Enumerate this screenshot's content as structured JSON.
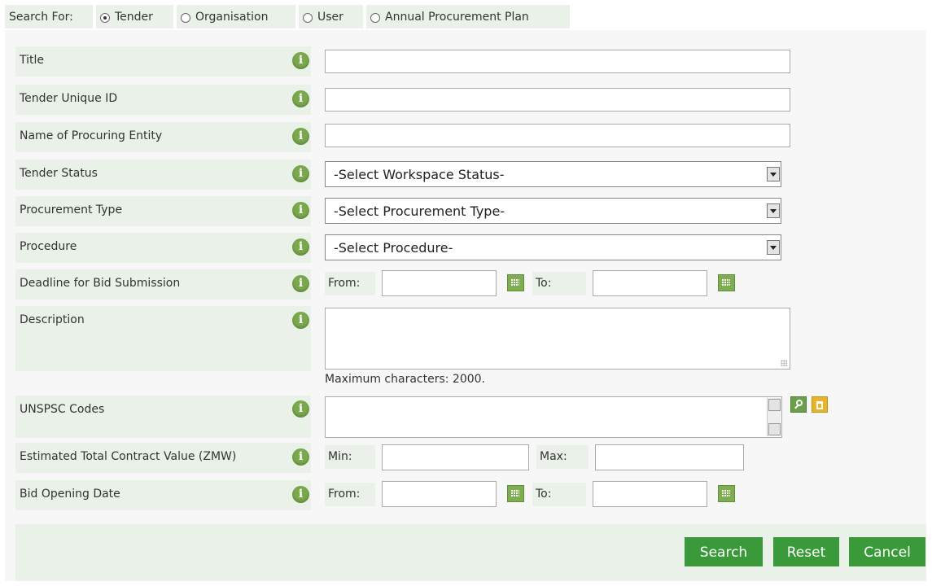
{
  "search_for": {
    "label": "Search For:",
    "options": [
      "Tender",
      "Organisation",
      "User",
      "Annual Procurement Plan"
    ],
    "selected": "Tender"
  },
  "fields": {
    "title": "Title",
    "tender_unique_id": "Tender Unique ID",
    "procuring_entity": "Name of Procuring Entity",
    "tender_status": "Tender Status",
    "procurement_type": "Procurement Type",
    "procedure": "Procedure",
    "deadline": "Deadline for Bid Submission",
    "description": "Description",
    "unspsc": "UNSPSC Codes",
    "contract_value": "Estimated Total Contract Value (ZMW)",
    "bid_opening": "Bid Opening Date"
  },
  "selects": {
    "tender_status": "-Select Workspace Status-",
    "procurement_type": "-Select Procurement Type-",
    "procedure": "-Select Procedure-"
  },
  "range_labels": {
    "from": "From:",
    "to": "To:",
    "min": "Min:",
    "max": "Max:"
  },
  "description_hint": "Maximum characters: 2000.",
  "info_glyph": "i",
  "buttons": {
    "search": "Search",
    "reset": "Reset",
    "cancel": "Cancel"
  },
  "colors": {
    "label_bg": "#eaf1e9",
    "button": "#3a9a3a",
    "info_icon": "#79a84d"
  }
}
